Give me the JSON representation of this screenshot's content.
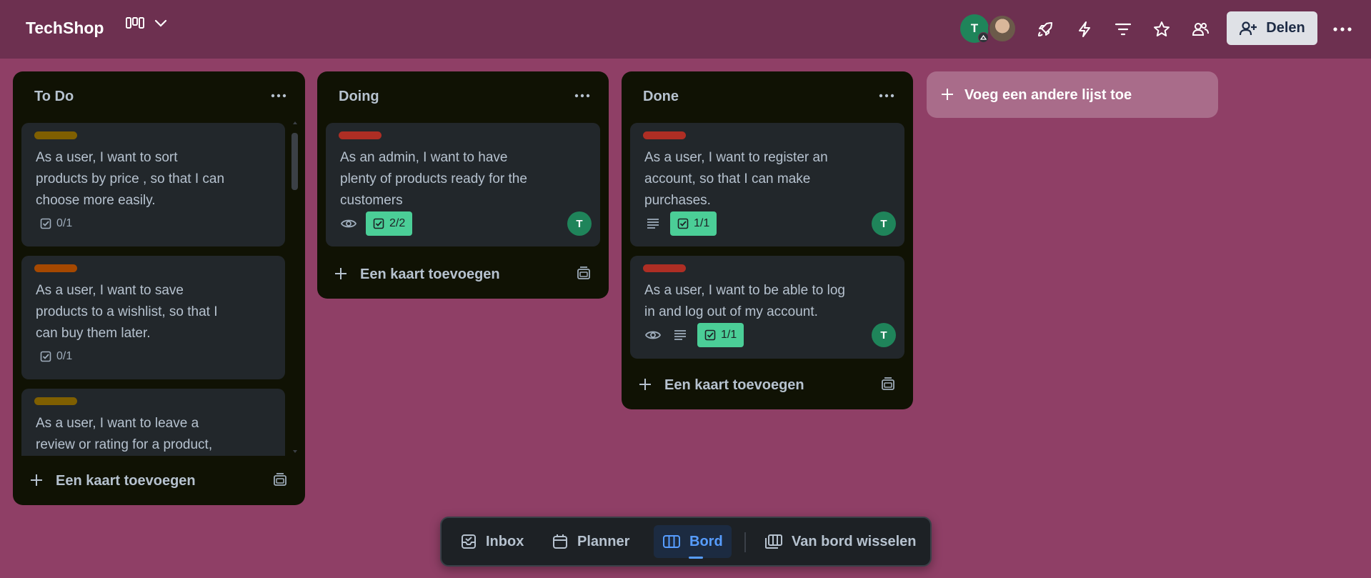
{
  "header": {
    "board_title": "TechShop",
    "view_icon": "board-columns-icon",
    "member_initial": "T",
    "share_label": "Delen",
    "icons": [
      "rocket-icon",
      "lightning-icon",
      "filter-icon",
      "star-icon",
      "people-icon",
      "more-icon"
    ]
  },
  "lists": [
    {
      "title": "To Do",
      "cards": [
        {
          "label_color": "#7f5f01",
          "text_lines": [
            "As a user, I want to sort",
            "products by price , so that I can",
            "choose more easily."
          ],
          "checklist": "0/1"
        },
        {
          "label_color": "#a54800",
          "text_lines": [
            "As a user, I want to save",
            "products to a wishlist, so that I",
            "can buy them later."
          ],
          "checklist": "0/1"
        },
        {
          "label_color": "#7f5f01",
          "text_lines": [
            "As a user, I want to leave a",
            "review or rating for a product,"
          ]
        }
      ],
      "add_card": "Een kaart toevoegen"
    },
    {
      "title": "Doing",
      "cards": [
        {
          "label_color": "#ae2e24",
          "text_lines": [
            "As an admin, I want to have",
            "plenty of products ready for the",
            "customers"
          ],
          "checklist": "2/2",
          "member": "T"
        }
      ],
      "add_card": "Een kaart toevoegen"
    },
    {
      "title": "Done",
      "cards": [
        {
          "label_color": "#ae2e24",
          "text_lines": [
            "As a user, I want to register an",
            "account, so that I can make",
            "purchases."
          ],
          "checklist": "1/1",
          "member": "T"
        },
        {
          "label_color": "#ae2e24",
          "text_lines": [
            "As a user, I want to be able to log",
            "in and log out of my account."
          ],
          "checklist": "1/1",
          "member": "T"
        }
      ],
      "add_card": "Een kaart toevoegen"
    }
  ],
  "add_list": "Voeg een andere lijst toe",
  "bottom_nav": {
    "inbox": "Inbox",
    "planner": "Planner",
    "board": "Bord",
    "switch": "Van bord wisselen"
  },
  "colors": {
    "background": "#8f3f66",
    "header": "#6d3050",
    "list": "#101204",
    "card": "#22272b",
    "checklist_done": "#4bce97",
    "member": "#1f845a",
    "active_nav": "#579dff"
  }
}
